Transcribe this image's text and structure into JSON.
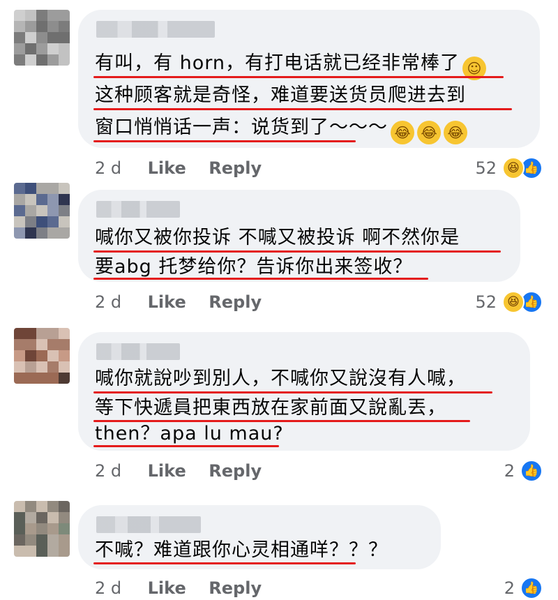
{
  "comments": [
    {
      "lines": [
        "有叫，有 horn，有打电话就已经非常棒了",
        "这种顾客就是奇怪，难道要送货员爬进去到",
        "窗口悄悄话一声：说货到了～～～"
      ],
      "line1_emoji": "smile-emoji",
      "line3_emojis": [
        "rofl-emoji",
        "joy-emoji",
        "rofl-emoji"
      ],
      "time": "2 d",
      "like_label": "Like",
      "reply_label": "Reply",
      "reaction_count": "52",
      "reactions": [
        "haha",
        "like"
      ]
    },
    {
      "lines": [
        "喊你又被你投诉 不喊又被投诉 啊不然你是",
        "要abg 托梦给你？告诉你出来签收？"
      ],
      "time": "2 d",
      "like_label": "Like",
      "reply_label": "Reply",
      "reaction_count": "52",
      "reactions": [
        "haha",
        "like"
      ]
    },
    {
      "lines": [
        "喊你就說吵到別人，不喊你又說沒有人喊，",
        "等下快遞員把東西放在家前面又說亂丟，",
        "then？apa lu mau?"
      ],
      "time": "2 d",
      "like_label": "Like",
      "reply_label": "Reply",
      "reaction_count": "2",
      "reactions": [
        "like"
      ]
    },
    {
      "lines": [
        "不喊？难道跟你心灵相通咩？？？"
      ],
      "time": "2 d",
      "like_label": "Like",
      "reply_label": "Reply",
      "reaction_count": "2",
      "reactions": [
        "like"
      ]
    }
  ],
  "colors": {
    "bubble": "#f0f2f5",
    "underline": "#e41b1b",
    "meta_text": "#65676b",
    "like_blue": "#1877f2",
    "haha_yellow": "#f7c531"
  }
}
